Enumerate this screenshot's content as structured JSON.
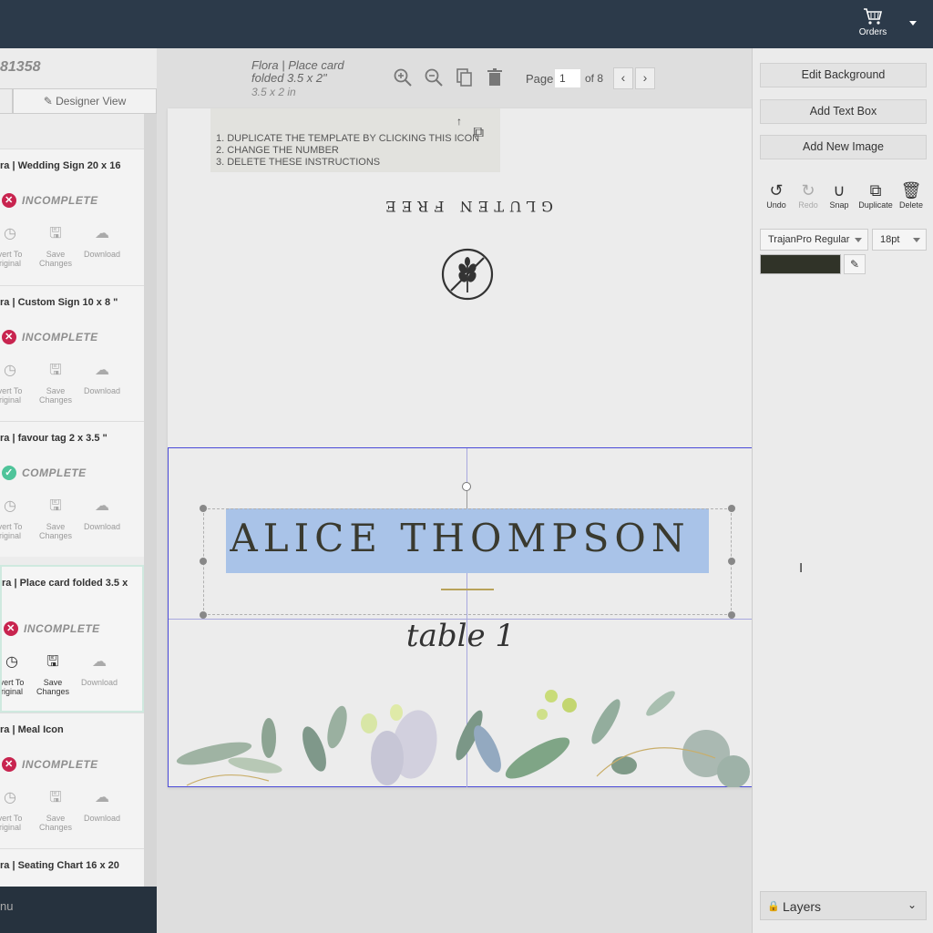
{
  "topbar": {
    "orders_label": "Orders",
    "cart_icon": "cart-icon"
  },
  "sidebar": {
    "order_number": "81358",
    "tab_designer": "Designer View",
    "items": [
      {
        "title": "ra | Wedding Sign 20 x 16",
        "status": "INCOMPLETE",
        "status_type": "bad"
      },
      {
        "title": "ra | Custom Sign 10 x 8 \"",
        "status": "INCOMPLETE",
        "status_type": "bad"
      },
      {
        "title": "ra | favour tag 2 x 3.5 \"",
        "status": "COMPLETE",
        "status_type": "good"
      },
      {
        "title": "ra | Place card folded 3.5 x",
        "status": "INCOMPLETE",
        "status_type": "bad"
      },
      {
        "title": "ra | Meal Icon",
        "status": "INCOMPLETE",
        "status_type": "bad"
      },
      {
        "title": "ra | Seating Chart 16 x 20",
        "status": "",
        "status_type": ""
      }
    ],
    "actions": {
      "revert_line1": "vert To",
      "revert_line2": "riginal",
      "save_line1": "Save",
      "save_line2": "Changes",
      "download": "Download"
    },
    "menu_label": "nu"
  },
  "document": {
    "title": "Flora | Place card folded 3.5 x 2\"",
    "size": "3.5 x 2 in",
    "page_label": "Page",
    "page_value": "1",
    "page_of": "of 8"
  },
  "canvas": {
    "instructions": [
      "1. DUPLICATE THE TEMPLATE BY CLICKING THIS ICON",
      "2. CHANGE THE NUMBER",
      "3. DELETE THESE INSTRUCTIONS"
    ],
    "gluten_text": "GLUTEN FREE",
    "name_text": "ALICE  THOMPSON",
    "table_text": "table 1"
  },
  "right_panel": {
    "edit_background": "Edit Background",
    "add_text_box": "Add Text Box",
    "add_new_image": "Add New Image",
    "undo": "Undo",
    "redo": "Redo",
    "snap": "Snap",
    "duplicate": "Duplicate",
    "delete": "Delete",
    "font_family": "TrajanPro Regular",
    "font_size": "18pt",
    "color": "#303328",
    "layers": "Layers"
  }
}
